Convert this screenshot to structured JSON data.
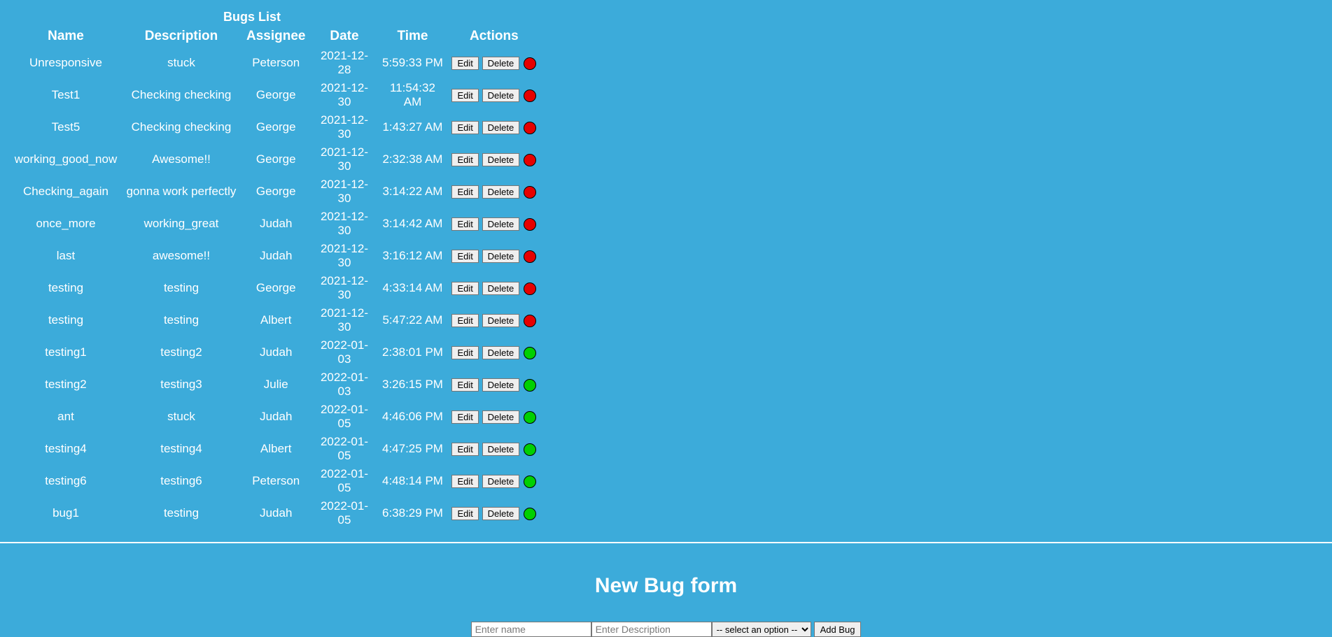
{
  "list_title": "Bugs List",
  "headers": {
    "name": "Name",
    "description": "Description",
    "assignee": "Assignee",
    "date": "Date",
    "time": "Time",
    "actions": "Actions"
  },
  "labels": {
    "edit": "Edit",
    "delete": "Delete"
  },
  "rows": [
    {
      "name": "Unresponsive",
      "description": "stuck",
      "assignee": "Peterson",
      "date": "2021-12-28",
      "time": "5:59:33 PM",
      "status": "red"
    },
    {
      "name": "Test1",
      "description": "Checking checking",
      "assignee": "George",
      "date": "2021-12-30",
      "time": "11:54:32 AM",
      "status": "red"
    },
    {
      "name": "Test5",
      "description": "Checking checking",
      "assignee": "George",
      "date": "2021-12-30",
      "time": "1:43:27 AM",
      "status": "red"
    },
    {
      "name": "working_good_now",
      "description": "Awesome!!",
      "assignee": "George",
      "date": "2021-12-30",
      "time": "2:32:38 AM",
      "status": "red"
    },
    {
      "name": "Checking_again",
      "description": "gonna work perfectly",
      "assignee": "George",
      "date": "2021-12-30",
      "time": "3:14:22 AM",
      "status": "red"
    },
    {
      "name": "once_more",
      "description": "working_great",
      "assignee": "Judah",
      "date": "2021-12-30",
      "time": "3:14:42 AM",
      "status": "red"
    },
    {
      "name": "last",
      "description": "awesome!!",
      "assignee": "Judah",
      "date": "2021-12-30",
      "time": "3:16:12 AM",
      "status": "red"
    },
    {
      "name": "testing",
      "description": "testing",
      "assignee": "George",
      "date": "2021-12-30",
      "time": "4:33:14 AM",
      "status": "red"
    },
    {
      "name": "testing",
      "description": "testing",
      "assignee": "Albert",
      "date": "2021-12-30",
      "time": "5:47:22 AM",
      "status": "red"
    },
    {
      "name": "testing1",
      "description": "testing2",
      "assignee": "Judah",
      "date": "2022-01-03",
      "time": "2:38:01 PM",
      "status": "green"
    },
    {
      "name": "testing2",
      "description": "testing3",
      "assignee": "Julie",
      "date": "2022-01-03",
      "time": "3:26:15 PM",
      "status": "green"
    },
    {
      "name": "ant",
      "description": "stuck",
      "assignee": "Judah",
      "date": "2022-01-05",
      "time": "4:46:06 PM",
      "status": "green"
    },
    {
      "name": "testing4",
      "description": "testing4",
      "assignee": "Albert",
      "date": "2022-01-05",
      "time": "4:47:25 PM",
      "status": "green"
    },
    {
      "name": "testing6",
      "description": "testing6",
      "assignee": "Peterson",
      "date": "2022-01-05",
      "time": "4:48:14 PM",
      "status": "green"
    },
    {
      "name": "bug1",
      "description": "testing",
      "assignee": "Judah",
      "date": "2022-01-05",
      "time": "6:38:29 PM",
      "status": "green"
    }
  ],
  "form": {
    "title": "New Bug form",
    "name_placeholder": "Enter name",
    "desc_placeholder": "Enter Description",
    "select_placeholder": "-- select an option --",
    "submit_label": "Add Bug"
  }
}
